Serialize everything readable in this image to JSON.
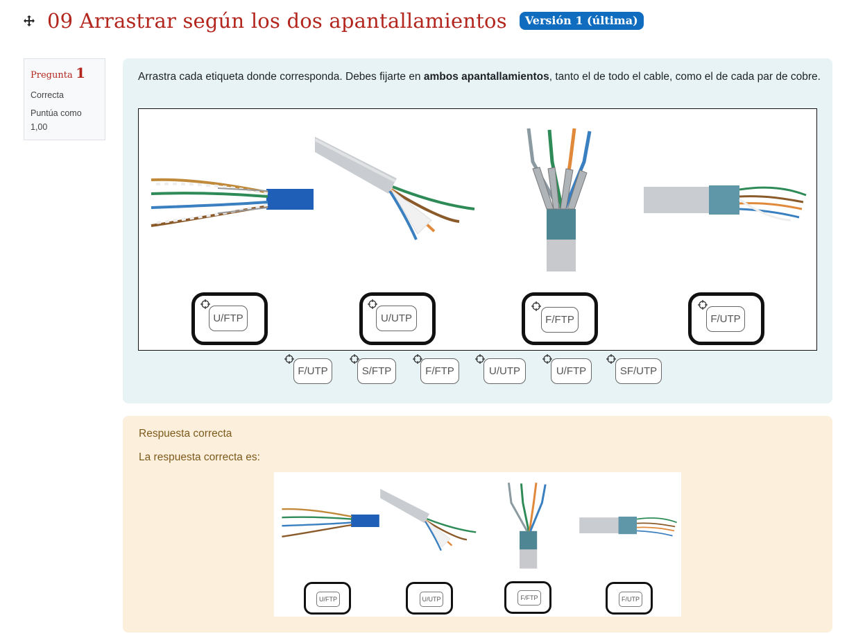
{
  "header": {
    "title": "09 Arrastrar según los dos apantallamientos",
    "version_badge": "Versión 1 (última)",
    "move_icon": "move-arrows-icon"
  },
  "question_info": {
    "label": "Pregunta",
    "number": "1",
    "state": "Correcta",
    "grade_label": "Puntúa como",
    "grade_value": "1,00"
  },
  "question": {
    "text_before": " Arrastra cada etiqueta donde corresponda. Debes fijarte en ",
    "text_bold": "ambos apantallamientos",
    "text_after": ", tanto el de todo el cable, como el de cada par de cobre.",
    "placed_labels": [
      "U/FTP",
      "U/UTP",
      "F/FTP",
      "F/UTP"
    ],
    "choice_labels": [
      "F/UTP",
      "S/FTP",
      "F/FTP",
      "U/UTP",
      "U/FTP",
      "SF/UTP"
    ]
  },
  "feedback": {
    "state_text": "Respuesta correcta",
    "right_answer_text": "La respuesta correcta es:",
    "answer_labels": [
      "U/FTP",
      "U/UTP",
      "F/FTP",
      "F/UTP"
    ]
  },
  "colors": {
    "title": "#b3261e",
    "badge": "#0f6cbf",
    "question_bg": "#e7f3f5",
    "feedback_bg": "#fcefdc",
    "feedback_text": "#7c5a1c"
  }
}
